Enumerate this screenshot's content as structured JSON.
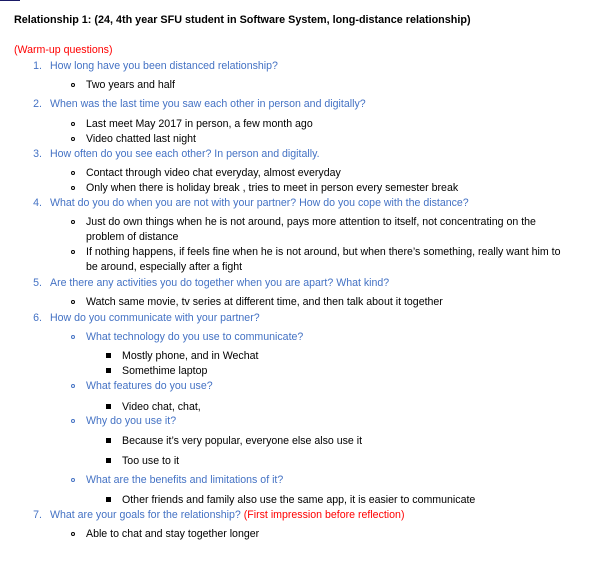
{
  "title": "Relationship 1: (24, 4th year SFU student in Software System, long-distance relationship)",
  "warmup": "(Warm-up questions)",
  "q1": {
    "num": "1.",
    "text": "How long have you been distanced relationship?",
    "a1": "Two years and half"
  },
  "q2": {
    "num": "2.",
    "text": "When was the last time you saw each other in person and digitally?",
    "a1": "Last meet May 2017 in person, a few month ago",
    "a2": "Video chatted last night"
  },
  "q3": {
    "num": "3.",
    "text": "How often do you see each other? In person and digitally.",
    "a1": "Contact through video chat everyday, almost everyday",
    "a2": "Only when there is holiday break , tries to meet in person every semester break"
  },
  "q4": {
    "num": "4.",
    "text": "What do you do when you are not with your partner? How do you cope with the distance?",
    "a1_l1": "Just do own things when he is not around, pays more attention to itself, not concentrating on the",
    "a1_l2": "problem of distance",
    "a2_l1": "If nothing happens, if feels fine when he is not around, but when there’s something, really want him to",
    "a2_l2": "be around, especially after a fight"
  },
  "q5": {
    "num": "5.",
    "text": "Are there any activities you do together when you are apart? What kind?",
    "a1": "Watch same movie, tv series at different time, and then talk about it together"
  },
  "q6": {
    "num": "6.",
    "text": "How do you communicate with your partner?",
    "s1": "What technology do you use to communicate?",
    "s1a1": "Mostly phone, and in Wechat",
    "s1a2": "Somethime laptop",
    "s2": "What features do you use?",
    "s2a1": "Video chat, chat,",
    "s3": "Why do you use it?",
    "s3a1": "Because it’s very popular, everyone else also use it",
    "s3a2": "Too use to it",
    "s4": "What are the benefits and limitations of it?",
    "s4a1": "Other friends and family also use the same app, it is easier to communicate"
  },
  "q7": {
    "num": "7.",
    "text": "What are your goals for the relationship?",
    "note": "(First impression before reflection)",
    "a1": "Able to chat and stay together longer"
  }
}
